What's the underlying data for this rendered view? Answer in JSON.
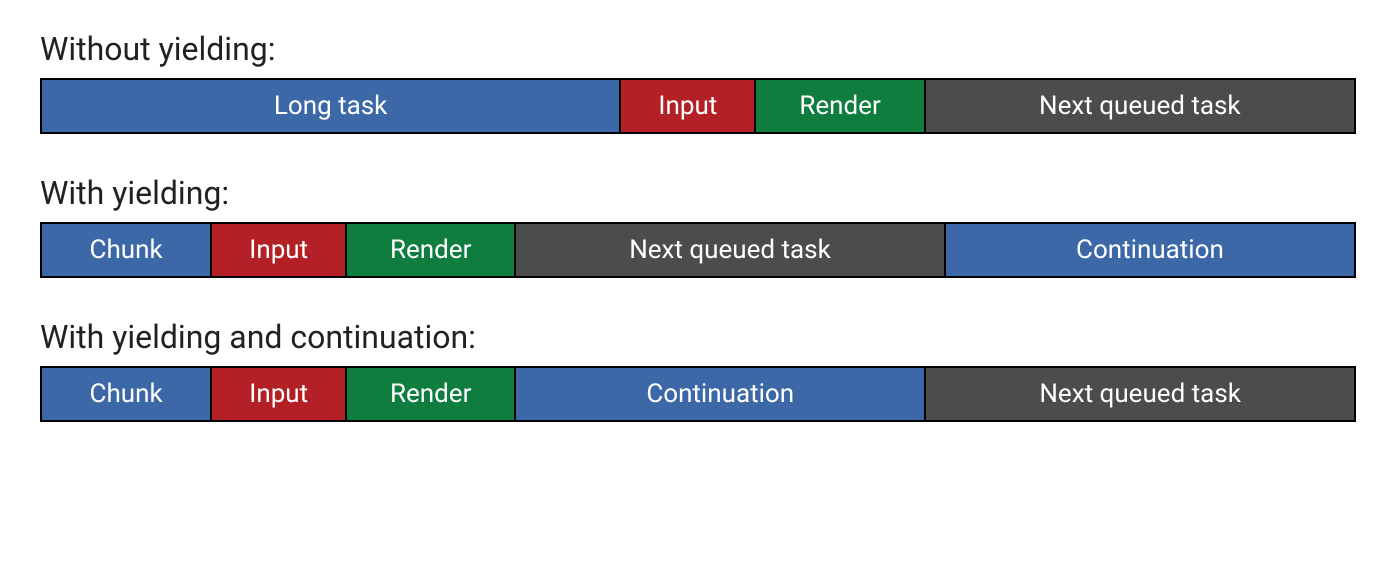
{
  "colors": {
    "blue": "#3c68a8",
    "red": "#b32126",
    "green": "#0e7d3e",
    "gray": "#4c4c4c"
  },
  "sections": [
    {
      "label": "Without yielding:",
      "segments": [
        {
          "text": "Long task",
          "color": "blue",
          "flex": 44.2
        },
        {
          "text": "Input",
          "color": "red",
          "flex": 10.2
        },
        {
          "text": "Render",
          "color": "green",
          "flex": 12.8
        },
        {
          "text": "Next queued task",
          "color": "gray",
          "flex": 32.8
        }
      ]
    },
    {
      "label": "With yielding:",
      "segments": [
        {
          "text": "Chunk",
          "color": "blue",
          "flex": 12.9
        },
        {
          "text": "Input",
          "color": "red",
          "flex": 10.2
        },
        {
          "text": "Render",
          "color": "green",
          "flex": 12.8
        },
        {
          "text": "Next queued task",
          "color": "gray",
          "flex": 32.8
        },
        {
          "text": "Continuation",
          "color": "blue",
          "flex": 31.3
        }
      ]
    },
    {
      "label": "With yielding and continuation:",
      "segments": [
        {
          "text": "Chunk",
          "color": "blue",
          "flex": 12.9
        },
        {
          "text": "Input",
          "color": "red",
          "flex": 10.2
        },
        {
          "text": "Render",
          "color": "green",
          "flex": 12.8
        },
        {
          "text": "Continuation",
          "color": "blue",
          "flex": 31.3
        },
        {
          "text": "Next queued task",
          "color": "gray",
          "flex": 32.8
        }
      ]
    }
  ]
}
